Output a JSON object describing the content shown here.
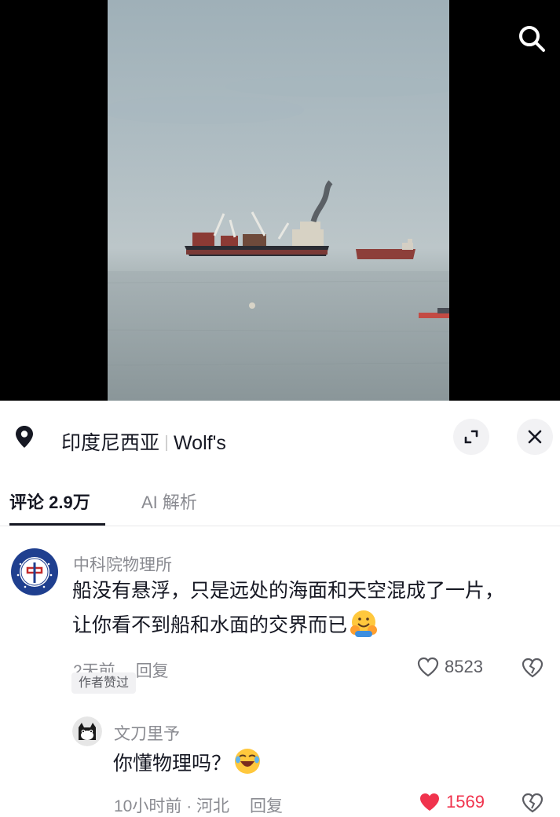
{
  "location": {
    "place": "印度尼西亚",
    "account": "Wolf's"
  },
  "tabs": [
    {
      "label": "评论 2.9万",
      "active": true
    },
    {
      "label": "AI 解析",
      "active": false
    }
  ],
  "comments": [
    {
      "username": "中科院物理所",
      "text_line1": "船没有悬浮，只是远处的海面和天空混成了一片，",
      "text_line2": "让你看不到船和水面的交界而已",
      "time": "2天前",
      "reply_label": "回复",
      "likes": "8523",
      "badge": "作者赞过",
      "liked": false
    },
    {
      "username": "文刀里予",
      "text": "你懂物理吗？",
      "time": "10小时前 · 河北",
      "reply_label": "回复",
      "likes": "1569",
      "liked": true
    }
  ],
  "colors": {
    "liked_heart": "#f0334d",
    "secondary_text": "#8a8b91",
    "primary_text": "#161823"
  },
  "icons": [
    "search-icon",
    "location-pin-icon",
    "expand-icon",
    "close-icon",
    "heart-icon",
    "dislike-heart-icon",
    "hug-emoji-icon",
    "laugh-emoji-icon"
  ]
}
